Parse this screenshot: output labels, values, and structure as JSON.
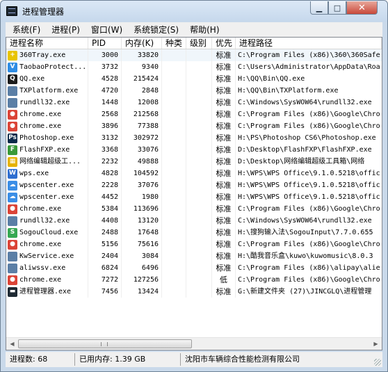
{
  "window": {
    "title": "进程管理器",
    "controls": {
      "minimize": "▁",
      "maximize": "□",
      "close": "✕"
    }
  },
  "menu": [
    "系统(F)",
    "进程(P)",
    "窗口(W)",
    "系统锁定(S)",
    "帮助(H)"
  ],
  "columns": {
    "name": "进程名称",
    "pid": "PID",
    "memory": "内存(K)",
    "kind": "种类",
    "level": "级别",
    "priority": "优先",
    "path": "进程路径"
  },
  "processes": [
    {
      "name": "360Tray.exe",
      "pid": "3000",
      "memory": "33820",
      "priority": "标准",
      "path": "C:\\Program Files (x86)\\360\\360Safe",
      "icon": "360-icon",
      "icon_color": "#e8c400",
      "icon_glyph": "+"
    },
    {
      "name": "TaobaoProtect...",
      "pid": "3732",
      "memory": "9340",
      "priority": "标准",
      "path": "C:\\Users\\Administrator\\AppData\\Roa",
      "icon": "shield-icon",
      "icon_color": "#2f8de4",
      "icon_glyph": "V"
    },
    {
      "name": "QQ.exe",
      "pid": "4528",
      "memory": "215424",
      "priority": "标准",
      "path": "H:\\QQ\\Bin\\QQ.exe",
      "icon": "qq-penguin-icon",
      "icon_color": "#1c1c1c",
      "icon_glyph": "Q"
    },
    {
      "name": "TXPlatform.exe",
      "pid": "4720",
      "memory": "2848",
      "priority": "标准",
      "path": "H:\\QQ\\Bin\\TXPlatform.exe",
      "icon": "window-app-icon",
      "icon_color": "#5b7fa6",
      "icon_glyph": ""
    },
    {
      "name": "rundll32.exe",
      "pid": "1448",
      "memory": "12008",
      "priority": "标准",
      "path": "C:\\Windows\\SysWOW64\\rundll32.exe",
      "icon": "window-app-icon",
      "icon_color": "#5b7fa6",
      "icon_glyph": ""
    },
    {
      "name": "chrome.exe",
      "pid": "2568",
      "memory": "212568",
      "priority": "标准",
      "path": "C:\\Program Files (x86)\\Google\\Chro",
      "icon": "chrome-icon",
      "icon_color": "#db4437",
      "icon_glyph": "●"
    },
    {
      "name": "chrome.exe",
      "pid": "3896",
      "memory": "77388",
      "priority": "标准",
      "path": "C:\\Program Files (x86)\\Google\\Chro",
      "icon": "chrome-icon",
      "icon_color": "#db4437",
      "icon_glyph": "●"
    },
    {
      "name": "Photoshop.exe",
      "pid": "3132",
      "memory": "302972",
      "priority": "标准",
      "path": "H:\\PS\\Photoshop CS6\\Photoshop.exe",
      "icon": "photoshop-icon",
      "icon_color": "#0b2a4a",
      "icon_glyph": "Ps"
    },
    {
      "name": "FlashFXP.exe",
      "pid": "3368",
      "memory": "33076",
      "priority": "标准",
      "path": "D:\\Desktop\\FlashFXP\\FlashFXP.exe",
      "icon": "flashfxp-icon",
      "icon_color": "#3a9a3a",
      "icon_glyph": "F"
    },
    {
      "name": "网络编辑超级工...",
      "pid": "2232",
      "memory": "49888",
      "priority": "标准",
      "path": "D:\\Desktop\\网络编辑超级工具箱\\网络",
      "icon": "toolbox-icon",
      "icon_color": "#e5b200",
      "icon_glyph": "▦"
    },
    {
      "name": "wps.exe",
      "pid": "4828",
      "memory": "104592",
      "priority": "标准",
      "path": "H:\\WPS\\WPS Office\\9.1.0.5218\\offic",
      "icon": "wps-icon",
      "icon_color": "#2f6fd0",
      "icon_glyph": "W"
    },
    {
      "name": "wpscenter.exe",
      "pid": "2228",
      "memory": "37076",
      "priority": "标准",
      "path": "H:\\WPS\\WPS Office\\9.1.0.5218\\offic",
      "icon": "cloud-icon",
      "icon_color": "#3b8ee6",
      "icon_glyph": "☁"
    },
    {
      "name": "wpscenter.exe",
      "pid": "4452",
      "memory": "1980",
      "priority": "标准",
      "path": "H:\\WPS\\WPS Office\\9.1.0.5218\\offic",
      "icon": "cloud-icon",
      "icon_color": "#3b8ee6",
      "icon_glyph": "☁"
    },
    {
      "name": "chrome.exe",
      "pid": "5384",
      "memory": "113696",
      "priority": "标准",
      "path": "C:\\Program Files (x86)\\Google\\Chro",
      "icon": "chrome-icon",
      "icon_color": "#db4437",
      "icon_glyph": "●"
    },
    {
      "name": "rundll32.exe",
      "pid": "4408",
      "memory": "13120",
      "priority": "标准",
      "path": "C:\\Windows\\SysWOW64\\rundll32.exe",
      "icon": "window-app-icon",
      "icon_color": "#5b7fa6",
      "icon_glyph": ""
    },
    {
      "name": "SogouCloud.exe",
      "pid": "2488",
      "memory": "17648",
      "priority": "标准",
      "path": "H:\\搜狗输入法\\SogouInput\\7.7.0.655",
      "icon": "sogou-icon",
      "icon_color": "#36a852",
      "icon_glyph": "S"
    },
    {
      "name": "chrome.exe",
      "pid": "5156",
      "memory": "75616",
      "priority": "标准",
      "path": "C:\\Program Files (x86)\\Google\\Chro",
      "icon": "chrome-icon",
      "icon_color": "#db4437",
      "icon_glyph": "●"
    },
    {
      "name": "KwService.exe",
      "pid": "2404",
      "memory": "3084",
      "priority": "标准",
      "path": "H:\\酷我音乐盒\\kuwo\\kuwomusic\\8.0.3",
      "icon": "window-app-icon",
      "icon_color": "#5b7fa6",
      "icon_glyph": ""
    },
    {
      "name": "aliwssv.exe",
      "pid": "6824",
      "memory": "6496",
      "priority": "标准",
      "path": "C:\\Program Files (x86)\\alipay\\alie",
      "icon": "window-app-icon",
      "icon_color": "#5b7fa6",
      "icon_glyph": ""
    },
    {
      "name": "chrome.exe",
      "pid": "7272",
      "memory": "127256",
      "priority": "低",
      "path": "C:\\Program Files (x86)\\Google\\Chro",
      "icon": "chrome-icon",
      "icon_color": "#db4437",
      "icon_glyph": "●"
    },
    {
      "name": "进程管理器.exe",
      "pid": "7456",
      "memory": "13424",
      "priority": "标准",
      "path": "G:\\新建文件夹 (27)\\JINCGLQ\\进程管理",
      "icon": "process-manager-icon",
      "icon_color": "#1f2a33",
      "icon_glyph": "▬"
    }
  ],
  "status": {
    "process_count": "进程数: 68",
    "used_memory": "已用内存: 1.39 GB",
    "company": "沈阳市车辆综合性能检测有限公司"
  }
}
